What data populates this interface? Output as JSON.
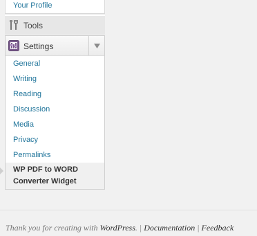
{
  "menu": {
    "profile_link": "Your Profile",
    "tools": {
      "label": "Tools",
      "icon": "tools-icon"
    },
    "settings": {
      "label": "Settings",
      "icon": "settings-icon",
      "toggle_icon": "triangle-down-icon",
      "items": [
        {
          "label": "General"
        },
        {
          "label": "Writing"
        },
        {
          "label": "Reading"
        },
        {
          "label": "Discussion"
        },
        {
          "label": "Media"
        },
        {
          "label": "Privacy"
        },
        {
          "label": "Permalinks"
        }
      ],
      "current_item": {
        "line1": "WP PDF to WORD",
        "line2": "Converter Widget"
      }
    }
  },
  "footer": {
    "thanks_prefix": "Thank you for creating with ",
    "wordpress_link": "WordPress",
    "dot": ".",
    "sep1": " | ",
    "documentation_link": "Documentation",
    "sep2": " | ",
    "feedback_link": "Feedback"
  },
  "colors": {
    "link": "#21759b",
    "background": "#f1f1f1",
    "tools_bg": "#e7e7e7"
  }
}
